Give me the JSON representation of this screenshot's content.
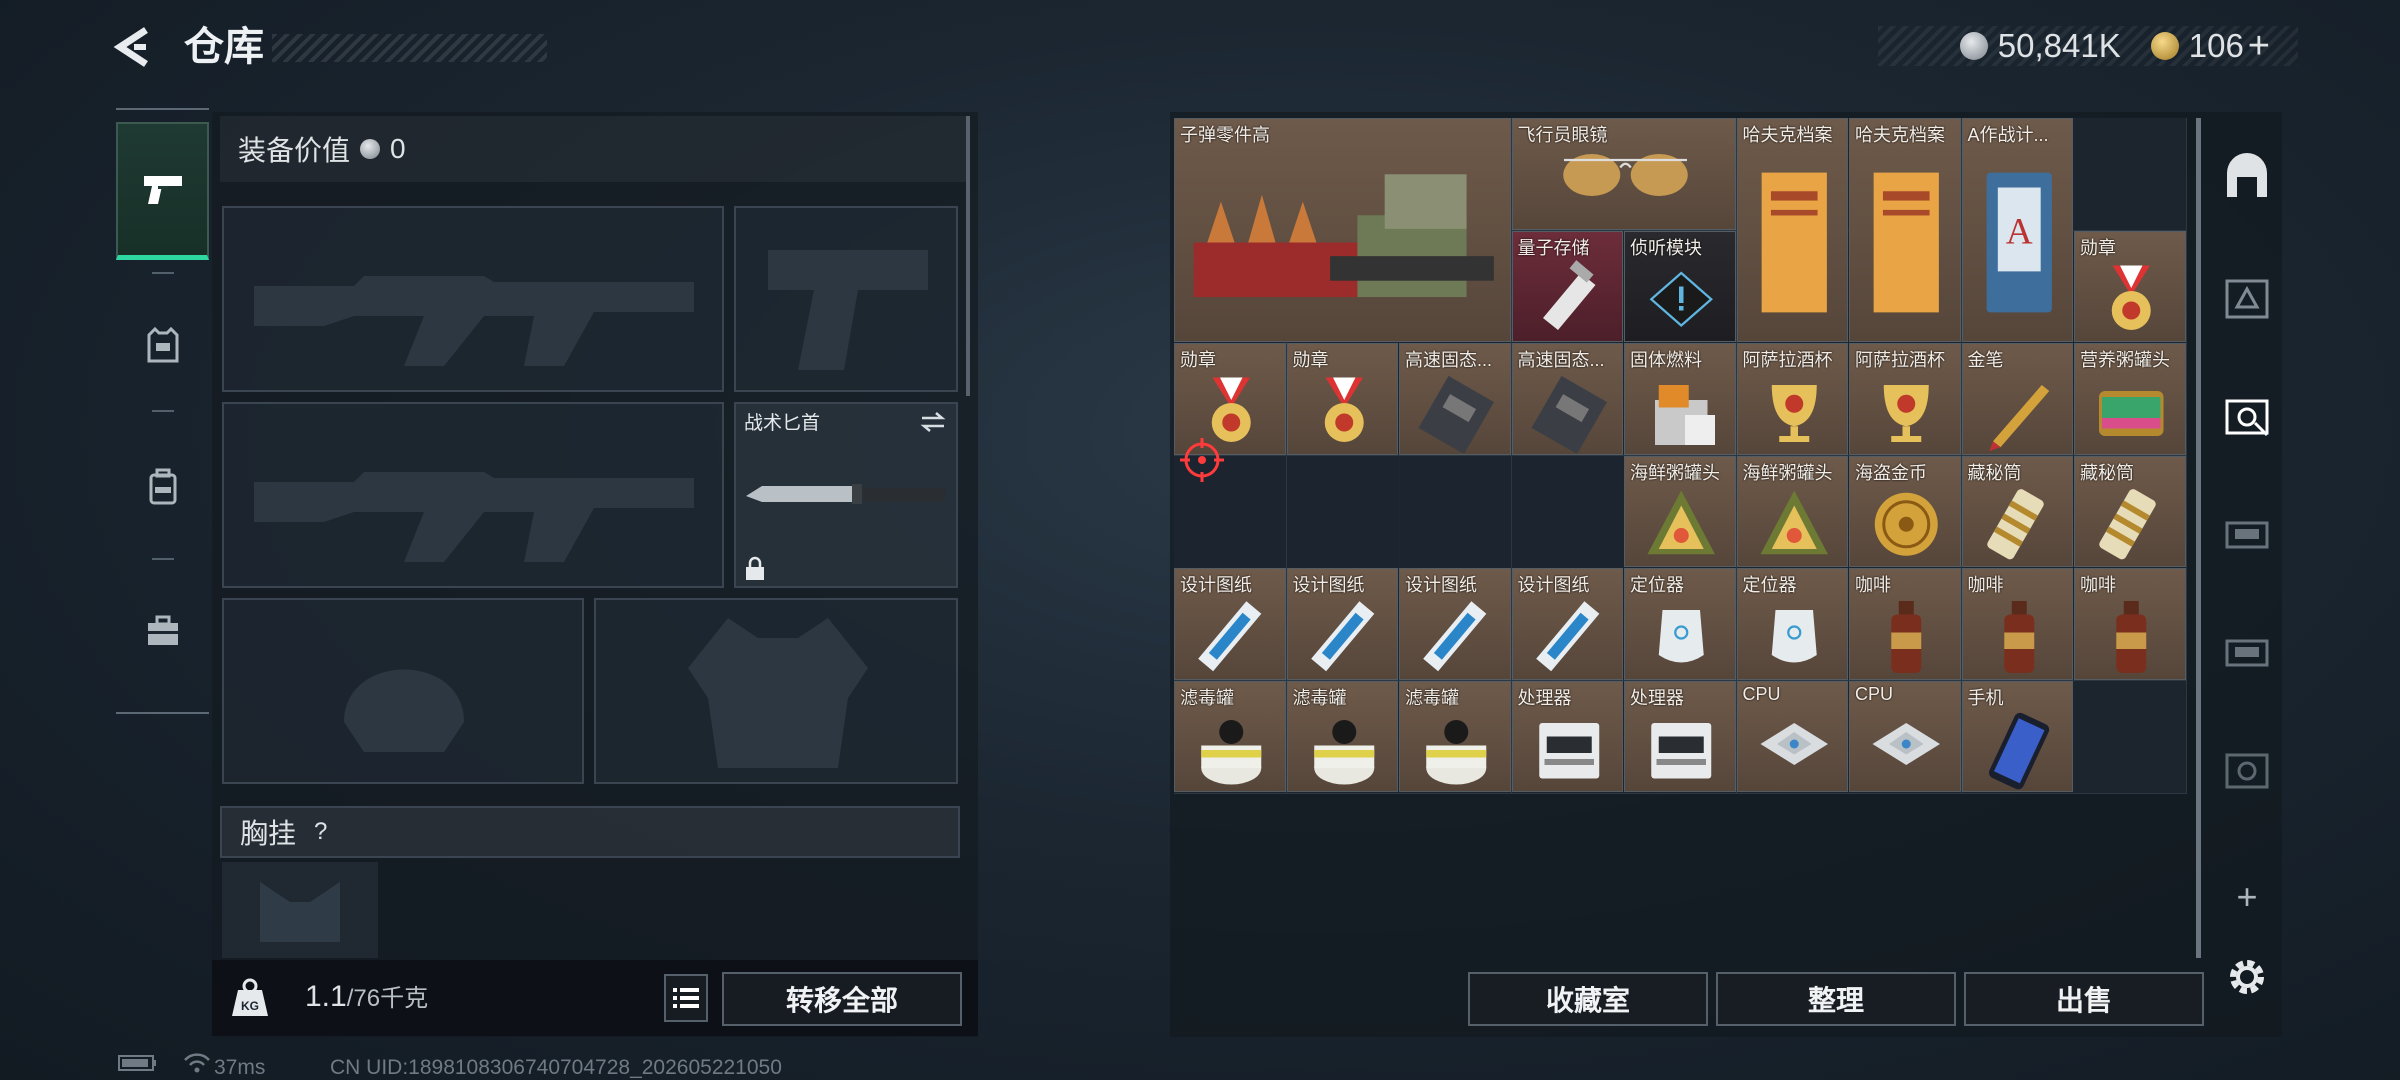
{
  "header": {
    "title": "仓库",
    "silver_amount": "50,841K",
    "gold_amount": "106",
    "gold_add": "+"
  },
  "loadout": {
    "equip_value_label": "装备价值",
    "equip_value": "0",
    "knife_label": "战术匕首",
    "chest_rig_label": "胸挂",
    "chest_rig_help": "?",
    "weight_unit_icon_text": "KG",
    "weight_current": "1.1",
    "weight_max": "/76千克",
    "transfer_all": "转移全部"
  },
  "stash": {
    "items": [
      {
        "name": "子弹零件高",
        "rarity": "rare-brown",
        "icon": "ammo-parts-box-icon"
      },
      {
        "name": "飞行员眼镜",
        "rarity": "rare-brown",
        "icon": "aviator-glasses-icon"
      },
      {
        "name": "哈夫克档案",
        "rarity": "rare-brown",
        "icon": "haavk-file-icon"
      },
      {
        "name": "哈夫克档案",
        "rarity": "rare-brown",
        "icon": "haavk-file-icon"
      },
      {
        "name": "A作战计...",
        "rarity": "rare-brown",
        "icon": "battle-plan-book-icon"
      },
      {
        "name": "量子存储",
        "rarity": "rare-red",
        "icon": "usb-drive-icon"
      },
      {
        "name": "侦听模块",
        "rarity": "rare-dark",
        "icon": "listening-module-icon"
      },
      {
        "name": "勋章",
        "rarity": "rare-brown",
        "icon": "medal-icon"
      },
      {
        "name": "勋章",
        "rarity": "rare-brown",
        "icon": "medal-icon"
      },
      {
        "name": "勋章",
        "rarity": "rare-brown",
        "icon": "medal-icon"
      },
      {
        "name": "高速固态...",
        "rarity": "rare-brown",
        "icon": "ssd-icon"
      },
      {
        "name": "高速固态...",
        "rarity": "rare-brown",
        "icon": "ssd-icon"
      },
      {
        "name": "固体燃料",
        "rarity": "rare-brown",
        "icon": "solid-fuel-icon"
      },
      {
        "name": "阿萨拉酒杯",
        "rarity": "rare-brown",
        "icon": "goblet-icon"
      },
      {
        "name": "阿萨拉酒杯",
        "rarity": "rare-brown",
        "icon": "goblet-icon"
      },
      {
        "name": "金笔",
        "rarity": "rare-brown",
        "icon": "gold-pen-icon"
      },
      {
        "name": "营养粥罐头",
        "rarity": "rare-brown",
        "icon": "porridge-can-icon"
      },
      {
        "name": "海鲜粥罐头",
        "rarity": "rare-brown",
        "icon": "seafood-can-icon"
      },
      {
        "name": "海鲜粥罐头",
        "rarity": "rare-brown",
        "icon": "seafood-can-icon"
      },
      {
        "name": "海盗金币",
        "rarity": "rare-brown",
        "icon": "pirate-coin-icon"
      },
      {
        "name": "藏秘筒",
        "rarity": "rare-brown",
        "icon": "cryptex-icon"
      },
      {
        "name": "藏秘筒",
        "rarity": "rare-brown",
        "icon": "cryptex-icon"
      },
      {
        "name": "设计图纸",
        "rarity": "rare-brown",
        "icon": "blueprint-icon"
      },
      {
        "name": "设计图纸",
        "rarity": "rare-brown",
        "icon": "blueprint-icon"
      },
      {
        "name": "设计图纸",
        "rarity": "rare-brown",
        "icon": "blueprint-icon"
      },
      {
        "name": "设计图纸",
        "rarity": "rare-brown",
        "icon": "blueprint-icon"
      },
      {
        "name": "定位器",
        "rarity": "rare-brown",
        "icon": "locator-icon"
      },
      {
        "name": "定位器",
        "rarity": "rare-brown",
        "icon": "locator-icon"
      },
      {
        "name": "咖啡",
        "rarity": "rare-brown",
        "icon": "coffee-bottle-icon"
      },
      {
        "name": "咖啡",
        "rarity": "rare-brown",
        "icon": "coffee-bottle-icon"
      },
      {
        "name": "咖啡",
        "rarity": "rare-brown",
        "icon": "coffee-bottle-icon"
      },
      {
        "name": "滤毒罐",
        "rarity": "rare-brown",
        "icon": "filter-canister-icon"
      },
      {
        "name": "滤毒罐",
        "rarity": "rare-brown",
        "icon": "filter-canister-icon"
      },
      {
        "name": "滤毒罐",
        "rarity": "rare-brown",
        "icon": "filter-canister-icon"
      },
      {
        "name": "处理器",
        "rarity": "rare-brown",
        "icon": "processor-module-icon"
      },
      {
        "name": "处理器",
        "rarity": "rare-brown",
        "icon": "processor-module-icon"
      },
      {
        "name": "CPU",
        "rarity": "rare-brown",
        "icon": "cpu-chip-icon"
      },
      {
        "name": "CPU",
        "rarity": "rare-brown",
        "icon": "cpu-chip-icon"
      },
      {
        "name": "手机",
        "rarity": "rare-brown",
        "icon": "phone-icon"
      }
    ],
    "buttons": {
      "collection": "收藏室",
      "organize": "整理",
      "sell": "出售"
    },
    "right_tab_add": "+"
  },
  "status": {
    "ping": "37ms",
    "uid": "CN UID:18981083067407047​28_202605221050"
  },
  "colors": {
    "accent_green": "#2dd9a0",
    "item_brown": "#6e5a4a",
    "item_red": "#6d2d3a",
    "target_red": "#ff3b3b"
  }
}
